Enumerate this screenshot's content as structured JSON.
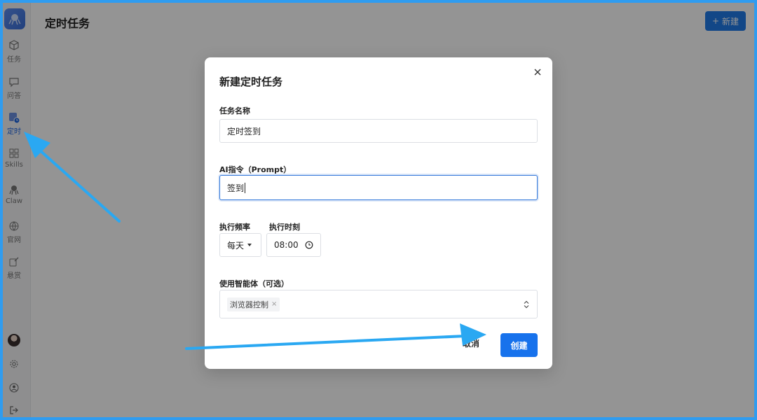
{
  "page": {
    "title": "定时任务",
    "new_label": "新建"
  },
  "sidebar": {
    "items": [
      {
        "label": "任务"
      },
      {
        "label": "问答"
      },
      {
        "label": "定时"
      },
      {
        "label": "Skills"
      },
      {
        "label": "Claw"
      },
      {
        "label": "官网"
      },
      {
        "label": "悬赏"
      }
    ]
  },
  "modal": {
    "title": "新建定时任务",
    "name_label": "任务名称",
    "name_value": "定时签到",
    "prompt_label": "AI指令（Prompt）",
    "prompt_value": "签到",
    "freq_label": "执行频率",
    "freq_value": "每天",
    "time_label": "执行时刻",
    "time_value": "08:00",
    "agent_label": "使用智能体（可选）",
    "agent_tag": "浏览器控制",
    "tag_remove": "×",
    "cancel_label": "取消",
    "create_label": "创建"
  },
  "colors": {
    "accent": "#1772ec",
    "annotation_arrow": "#2aa8f2",
    "frame_border": "#2f9cf0"
  }
}
